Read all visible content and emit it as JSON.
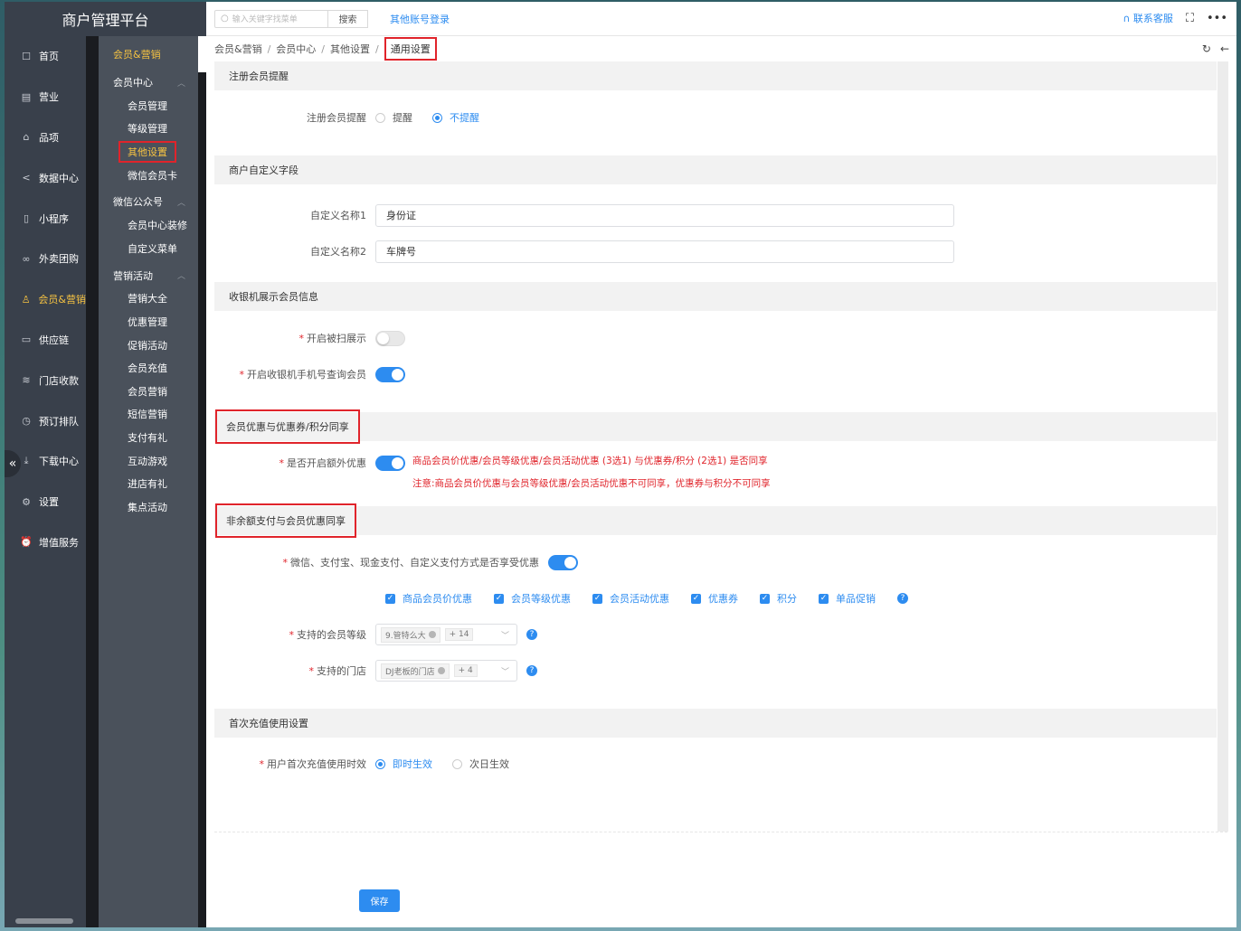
{
  "app": {
    "title": "商户管理平台"
  },
  "topbar": {
    "search_placeholder": "输入关键字找菜单",
    "search_button": "搜索",
    "other_login": "其他账号登录",
    "support": "联系客服"
  },
  "nav": [
    {
      "label": "首页",
      "icon": "home-icon",
      "glyph": "☐"
    },
    {
      "label": "营业",
      "icon": "calendar-icon",
      "glyph": "▤"
    },
    {
      "label": "品项",
      "icon": "bag-icon",
      "glyph": "⌂"
    },
    {
      "label": "数据中心",
      "icon": "share-icon",
      "glyph": "<"
    },
    {
      "label": "小程序",
      "icon": "phone-icon",
      "glyph": "▯"
    },
    {
      "label": "外卖团购",
      "icon": "bike-icon",
      "glyph": "∞"
    },
    {
      "label": "会员&营销",
      "icon": "user-icon",
      "glyph": "♙",
      "active": true
    },
    {
      "label": "供应链",
      "icon": "truck-icon",
      "glyph": "▭"
    },
    {
      "label": "门店收款",
      "icon": "database-icon",
      "glyph": "≋"
    },
    {
      "label": "预订排队",
      "icon": "clock-icon",
      "glyph": "◷"
    },
    {
      "label": "下载中心",
      "icon": "download-icon",
      "glyph": "⤓"
    },
    {
      "label": "设置",
      "icon": "gear-icon",
      "glyph": "⚙"
    },
    {
      "label": "增值服务",
      "icon": "alarm-icon",
      "glyph": "⏰"
    }
  ],
  "submenu": {
    "title": "会员&营销",
    "groups": [
      {
        "label": "会员中心",
        "items": [
          "会员管理",
          "等级管理",
          "其他设置",
          "微信会员卡"
        ]
      },
      {
        "label": "微信公众号",
        "items": [
          "会员中心装修",
          "自定义菜单"
        ]
      },
      {
        "label": "营销活动",
        "items": [
          "营销大全",
          "优惠管理",
          "促销活动",
          "会员充值",
          "会员营销",
          "短信营销",
          "支付有礼",
          "互动游戏",
          "进店有礼",
          "集点活动"
        ]
      }
    ],
    "selected": "其他设置"
  },
  "breadcrumb": [
    "会员&营销",
    "会员中心",
    "其他设置",
    "通用设置"
  ],
  "sections": {
    "register": {
      "title": "注册会员提醒",
      "label": "注册会员提醒",
      "options": [
        "提醒",
        "不提醒"
      ],
      "selected": "不提醒"
    },
    "custom_fields": {
      "title": "商户自定义字段",
      "fields": [
        {
          "label": "自定义名称1",
          "value": "身份证"
        },
        {
          "label": "自定义名称2",
          "value": "车牌号"
        }
      ]
    },
    "cashier": {
      "title": "收银机展示会员信息",
      "scan_label": "开启被扫展示",
      "scan_on": false,
      "phone_label": "开启收银机手机号查询会员",
      "phone_on": true
    },
    "discount_share": {
      "title": "会员优惠与优惠券/积分同享",
      "label": "是否开启额外优惠",
      "on": true,
      "note1": "商品会员价优惠/会员等级优惠/会员活动优惠 (3选1) 与优惠券/积分 (2选1) 是否同享",
      "note2": "注意:商品会员价优惠与会员等级优惠/会员活动优惠不可同享，优惠券与积分不可同享"
    },
    "nonbalance": {
      "title": "非余额支付与会员优惠同享",
      "label": "微信、支付宝、现金支付、自定义支付方式是否享受优惠",
      "on": true,
      "checks": [
        "商品会员价优惠",
        "会员等级优惠",
        "会员活动优惠",
        "优惠券",
        "积分",
        "单品促销"
      ],
      "level_label": "支持的会员等级",
      "level_tag": "9.管特么大",
      "level_more": "+ 14",
      "store_label": "支持的门店",
      "store_tag": "DJ老板的门店",
      "store_more": "+ 4"
    },
    "first_recharge": {
      "title": "首次充值使用设置",
      "label": "用户首次充值使用时效",
      "options": [
        "即时生效",
        "次日生效"
      ],
      "selected": "即时生效"
    }
  },
  "save_label": "保存",
  "colors": {
    "accent": "#2d8cf0",
    "highlight": "#e0242b",
    "active_nav": "#f5c242",
    "sidebar": "#39404b"
  }
}
